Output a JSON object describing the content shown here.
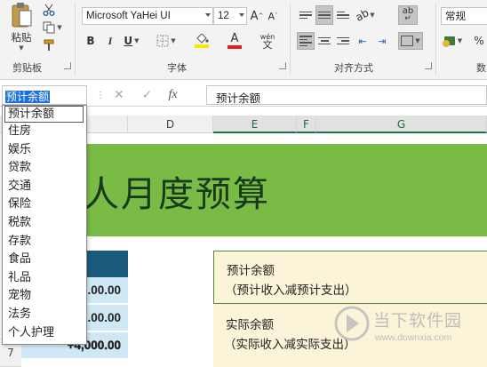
{
  "ribbon": {
    "clipboard": {
      "paste_label": "粘贴",
      "group_label": "剪贴板"
    },
    "font": {
      "font_name": "Microsoft YaHei UI",
      "font_size": "12",
      "group_label": "字体",
      "bold": "B",
      "italic": "I",
      "underline": "U",
      "font_color_letter": "A",
      "phonetic": "wén"
    },
    "alignment": {
      "group_label": "对齐方式",
      "wrap_letters": "ab"
    },
    "number": {
      "format": "常规",
      "group_label": "数"
    }
  },
  "formula_bar": {
    "name_box": "预计余额",
    "formula": "预计余额",
    "fx": "fx"
  },
  "columns": [
    "D",
    "E",
    "F",
    "G"
  ],
  "rows": [
    "7"
  ],
  "dropdown": {
    "items": [
      "预计余额",
      "住房",
      "娱乐",
      "贷款",
      "交通",
      "保险",
      "税款",
      "存款",
      "食品",
      "礼品",
      "宠物",
      "法务",
      "个人护理"
    ]
  },
  "sheet": {
    "title": "人月度预算",
    "values": [
      ".00.00",
      ".00.00",
      "+4,000.00"
    ],
    "box1_line1": "预计余额",
    "box1_line2": "（预计收入减预计支出）",
    "box2_line1": "实际余额",
    "box2_line2": "（实际收入减实际支出）"
  },
  "watermark": {
    "text_cn": "当下软件园",
    "text_url": "www.downxia.com"
  },
  "colors": {
    "green_band": "#79bb44",
    "table_header": "#1c5a7d",
    "cell_fill": "#cfe8f5",
    "note_fill": "#fbf4d9"
  }
}
